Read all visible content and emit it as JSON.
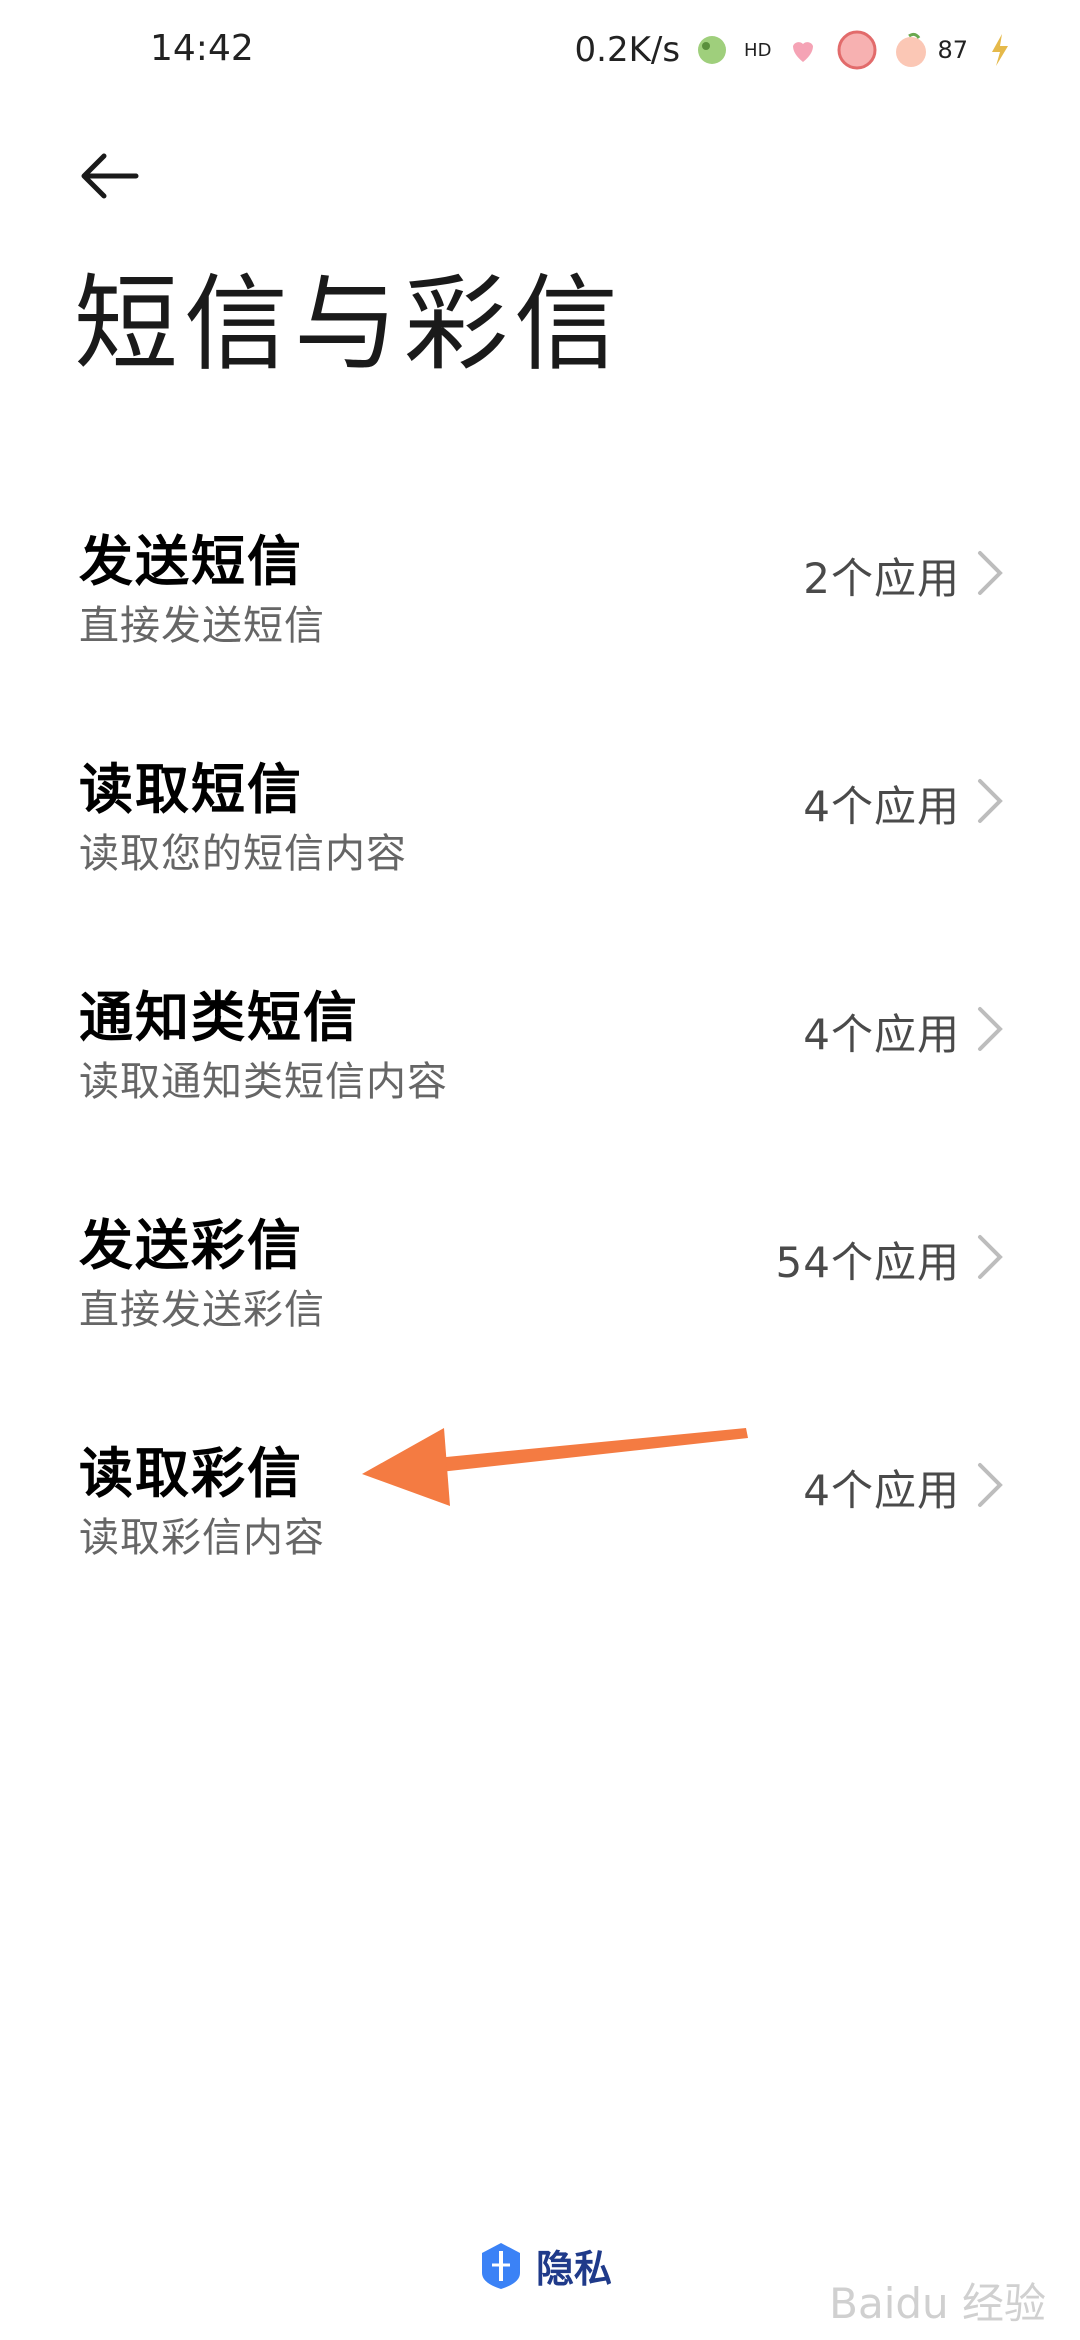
{
  "status_bar": {
    "time": "14:42",
    "net_speed": "0.2K/s",
    "hd_label": "HD",
    "battery_level": "87"
  },
  "header": {
    "back_icon": "back-arrow-icon",
    "title": "短信与彩信"
  },
  "items": [
    {
      "title": "发送短信",
      "subtitle": "直接发送短信",
      "count": "2个应用"
    },
    {
      "title": "读取短信",
      "subtitle": "读取您的短信内容",
      "count": "4个应用"
    },
    {
      "title": "通知类短信",
      "subtitle": "读取通知类短信内容",
      "count": "4个应用"
    },
    {
      "title": "发送彩信",
      "subtitle": "直接发送彩信",
      "count": "54个应用"
    },
    {
      "title": "读取彩信",
      "subtitle": "读取彩信内容",
      "count": "4个应用"
    }
  ],
  "annotation": {
    "color": "#f47b42"
  },
  "footer": {
    "label": "隐私",
    "icon": "privacy-shield-icon",
    "color": "#1f3a8a"
  },
  "watermark": "Baidu 经验"
}
